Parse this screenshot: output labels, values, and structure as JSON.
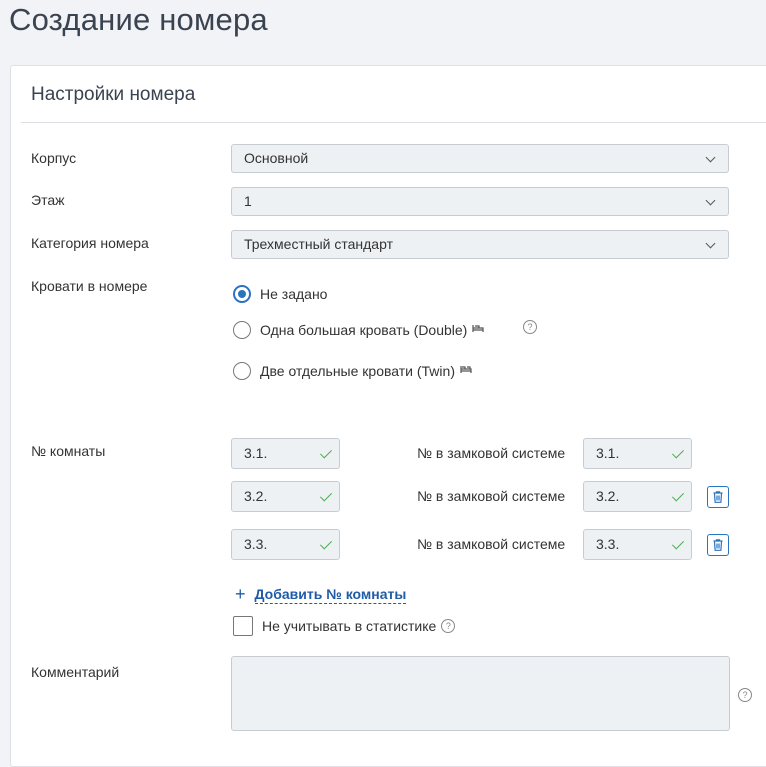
{
  "page": {
    "title": "Создание номера"
  },
  "section": {
    "title": "Настройки номера"
  },
  "fields": {
    "building": {
      "label": "Корпус",
      "value": "Основной"
    },
    "floor": {
      "label": "Этаж",
      "value": "1"
    },
    "category": {
      "label": "Категория номера",
      "value": "Трехместный стандарт"
    },
    "beds": {
      "label": "Кровати в номере",
      "options": [
        {
          "label": "Не задано",
          "checked": true
        },
        {
          "label": "Одна большая кровать (Double)",
          "checked": false
        },
        {
          "label": "Две отдельные кровати (Twin)",
          "checked": false
        }
      ]
    },
    "room_numbers": {
      "label": "№ комнаты",
      "lock_label": "№ в замковой системе",
      "rows": [
        {
          "number": "3.1.",
          "lock": "3.1."
        },
        {
          "number": "3.2.",
          "lock": "3.2."
        },
        {
          "number": "3.3.",
          "lock": "3.3."
        }
      ],
      "add_label": "Добавить № комнаты"
    },
    "exclude_stats": {
      "label": "Не учитывать в статистике",
      "checked": false
    },
    "comment": {
      "label": "Комментарий",
      "value": ""
    }
  },
  "icons": {
    "help": "question-circle-icon",
    "trash": "trash-icon",
    "check": "check-icon",
    "chevron": "chevron-down-icon",
    "bed": "bed-icon"
  },
  "colors": {
    "accent": "#2a73c0",
    "link": "#1e5ba8",
    "valid": "#4caf50"
  }
}
